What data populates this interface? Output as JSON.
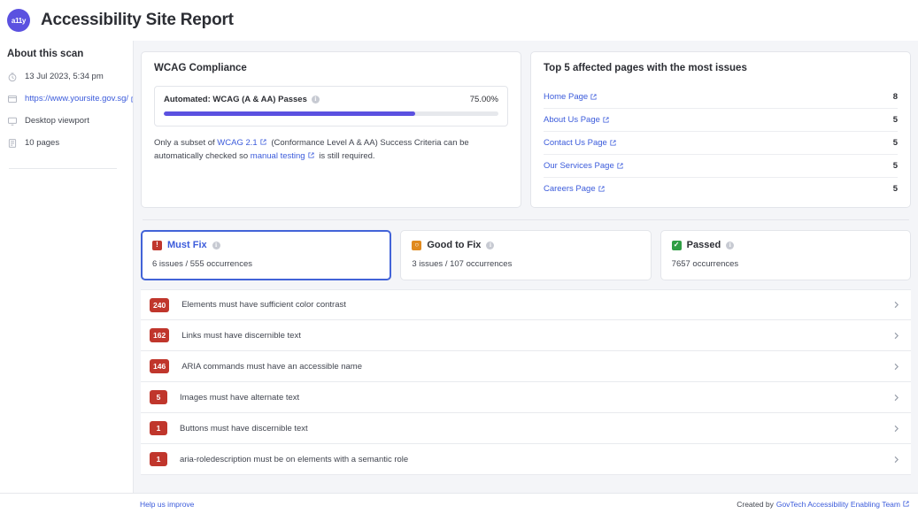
{
  "header": {
    "logo_text": "a11y",
    "title": "Accessibility Site Report",
    "accent_color": "#5b51e0"
  },
  "sidebar": {
    "heading": "About this scan",
    "items": [
      {
        "icon": "clock-icon",
        "text": "13 Jul 2023, 5:34 pm",
        "is_link": false
      },
      {
        "icon": "browser-window-icon",
        "text": "https://www.yoursite.gov.sg/",
        "is_link": true
      },
      {
        "icon": "desktop-monitor-icon",
        "text": "Desktop viewport",
        "is_link": false
      },
      {
        "icon": "pages-icon",
        "text": "10 pages",
        "is_link": false
      }
    ]
  },
  "wcag_card": {
    "title": "WCAG Compliance",
    "metric_label": "Automated: WCAG (A & AA) Passes",
    "metric_value": "75.00%",
    "progress_percent": 75,
    "progress_color": "#5b51e0",
    "note_part1": "Only a subset of ",
    "note_link1": "WCAG 2.1",
    "note_part2": " (Conformance Level A & AA) Success Criteria can be automatically checked so ",
    "note_link2": "manual testing",
    "note_part3": " is still required."
  },
  "top_pages_card": {
    "title": "Top 5 affected pages with the most issues",
    "rows": [
      {
        "label": "Home Page",
        "count": "8"
      },
      {
        "label": "About Us Page",
        "count": "5"
      },
      {
        "label": "Contact Us Page",
        "count": "5"
      },
      {
        "label": "Our Services Page",
        "count": "5"
      },
      {
        "label": "Careers Page",
        "count": "5"
      }
    ]
  },
  "tabs": [
    {
      "label": "Must Fix",
      "sub": "6 issues / 555 occurrences",
      "icon": "exclamation-square-icon",
      "icon_glyph": "!",
      "color": "#c0362c",
      "active": true
    },
    {
      "label": "Good to Fix",
      "sub": "3 issues / 107 occurrences",
      "icon": "warning-square-icon",
      "icon_glyph": "○",
      "color": "#e08a1e",
      "active": false
    },
    {
      "label": "Passed",
      "sub": "7657 occurrences",
      "icon": "check-square-icon",
      "icon_glyph": "✓",
      "color": "#2f9e44",
      "active": false
    }
  ],
  "issues": [
    {
      "count": "240",
      "text": "Elements must have sufficient color contrast"
    },
    {
      "count": "162",
      "text": "Links must have discernible text"
    },
    {
      "count": "146",
      "text": "ARIA commands must have an accessible name"
    },
    {
      "count": "5",
      "text": "Images must have alternate text"
    },
    {
      "count": "1",
      "text": "Buttons must have discernible text"
    },
    {
      "count": "1",
      "text": "aria-roledescription must be on elements with a semantic role"
    }
  ],
  "footer": {
    "left_link": "Help us improve",
    "right_prefix": "Created by ",
    "right_link": "GovTech Accessibility Enabling Team"
  }
}
